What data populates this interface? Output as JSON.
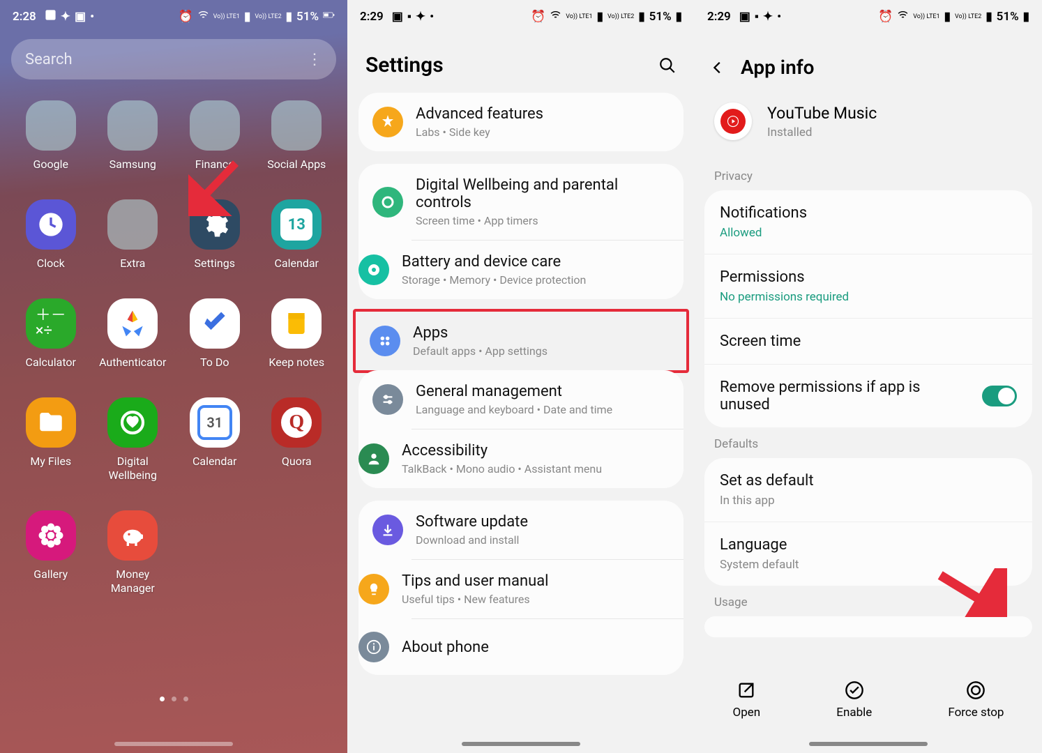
{
  "statusbar": {
    "time1": "2:28",
    "time2": "2:29",
    "time3": "2:29",
    "battery": "51%",
    "net1": "Vo)) LTE1",
    "net2": "Vo)) LTE2"
  },
  "screen1": {
    "search_placeholder": "Search",
    "apps": [
      {
        "label": "Google",
        "type": "folder",
        "minis": [
          "#ea4335",
          "#4285f4",
          "#34a853",
          "#fbbc05",
          "#ea4335",
          "#4285f4",
          "#34a853",
          "#fbbc05",
          "#ea4335"
        ]
      },
      {
        "label": "Samsung",
        "type": "folder",
        "minis": [
          "#e74c3c",
          "#3498db",
          "#1abc9c",
          "#3498db",
          "#9b59b6",
          "#f39c12",
          "#c0392b",
          "#8e44ad",
          "#d35400"
        ]
      },
      {
        "label": "Finance",
        "type": "folder",
        "minis": [
          "#8e44ad",
          "#f1c40f",
          "#2980b9",
          "#16a085",
          "#c0392b",
          "#27ae60",
          "#e67e22",
          "#2c3e50",
          "#1abc9c"
        ]
      },
      {
        "label": "Social Apps",
        "type": "folder",
        "minis": [
          "#25d366",
          "#0088cc",
          "#1da1f2",
          "#ff4500",
          "#0a66c2",
          "#e4405f",
          "",
          "",
          ""
        ]
      },
      {
        "label": "Clock",
        "color": "#5b56d6",
        "glyph": "clock"
      },
      {
        "label": "Extra",
        "type": "folder",
        "minis": [
          "#e74c3c",
          "#3498db",
          "#f1c40f",
          "#1abc9c",
          "#9b59b6",
          "#e67e22",
          "#2980b9",
          "#c0392b",
          "#16a085"
        ]
      },
      {
        "label": "Settings",
        "color": "#2e4a63",
        "glyph": "gear"
      },
      {
        "label": "Calendar",
        "color": "#1ea5a0",
        "glyph": "cal13",
        "text": "13"
      },
      {
        "label": "Calculator",
        "color": "#2aa92a",
        "glyph": "calc"
      },
      {
        "label": "Authenticator",
        "color": "#ffffff",
        "glyph": "auth"
      },
      {
        "label": "To Do",
        "color": "#ffffff",
        "glyph": "check"
      },
      {
        "label": "Keep notes",
        "color": "#ffffff",
        "glyph": "keep"
      },
      {
        "label": "My Files",
        "color": "#f39c12",
        "glyph": "folder"
      },
      {
        "label": "Digital Wellbeing",
        "color": "#1aab1a",
        "glyph": "heart"
      },
      {
        "label": "Calendar",
        "color": "#ffffff",
        "glyph": "gcal",
        "text": "31"
      },
      {
        "label": "Quora",
        "color": "#b92b27",
        "glyph": "Q"
      },
      {
        "label": "Gallery",
        "color": "#d6197c",
        "glyph": "flower"
      },
      {
        "label": "Money Manager",
        "color": "#e74c3c",
        "glyph": "piggy"
      }
    ]
  },
  "screen2": {
    "title": "Settings",
    "groups": [
      [
        {
          "title": "Advanced features",
          "sub": "Labs  •  Side key",
          "icon": "#f6a71b",
          "glyph": "star"
        }
      ],
      [
        {
          "title": "Digital Wellbeing and parental controls",
          "sub": "Screen time  •  App timers",
          "icon": "#2fb67c",
          "glyph": "circle"
        },
        {
          "title": "Battery and device care",
          "sub": "Storage  •  Memory  •  Device protection",
          "icon": "#16c0a3",
          "glyph": "care"
        },
        {
          "title": "Apps",
          "sub": "Default apps  •  App settings",
          "icon": "#5b8def",
          "glyph": "grid",
          "highlight": true
        }
      ],
      [
        {
          "title": "General management",
          "sub": "Language and keyboard  •  Date and time",
          "icon": "#7a8a9a",
          "glyph": "sliders"
        },
        {
          "title": "Accessibility",
          "sub": "TalkBack  •  Mono audio  •  Assistant menu",
          "icon": "#2a8b52",
          "glyph": "person"
        }
      ],
      [
        {
          "title": "Software update",
          "sub": "Download and install",
          "icon": "#6a5ae0",
          "glyph": "down"
        },
        {
          "title": "Tips and user manual",
          "sub": "Useful tips  •  New features",
          "icon": "#f6a71b",
          "glyph": "bulb"
        },
        {
          "title": "About phone",
          "sub": "",
          "icon": "#7a8a9a",
          "glyph": "info"
        }
      ]
    ]
  },
  "screen3": {
    "title": "App info",
    "app_name": "YouTube Music",
    "app_status": "Installed",
    "sections": {
      "privacy_label": "Privacy",
      "defaults_label": "Defaults",
      "usage_label": "Usage"
    },
    "rows": {
      "notifications": {
        "title": "Notifications",
        "sub": "Allowed"
      },
      "permissions": {
        "title": "Permissions",
        "sub": "No permissions required"
      },
      "screentime": {
        "title": "Screen time"
      },
      "remove_perms": {
        "title": "Remove permissions if app is unused"
      },
      "set_default": {
        "title": "Set as default",
        "sub": "In this app"
      },
      "language": {
        "title": "Language",
        "sub": "System default"
      }
    },
    "actions": {
      "open": "Open",
      "enable": "Enable",
      "forcestop": "Force stop"
    }
  }
}
